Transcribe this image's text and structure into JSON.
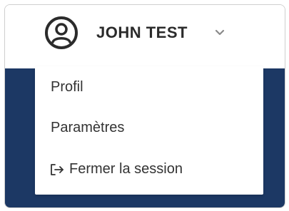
{
  "user": {
    "name": "JOHN TEST",
    "avatar_icon": "user-circle-icon",
    "dropdown_icon": "chevron-down-icon"
  },
  "menu": {
    "items": [
      {
        "label": "Profil"
      },
      {
        "label": "Paramètres"
      },
      {
        "label": "Fermer la session",
        "icon": "logout-icon"
      }
    ]
  },
  "colors": {
    "panel_background": "#1c3864",
    "text": "#333333"
  }
}
